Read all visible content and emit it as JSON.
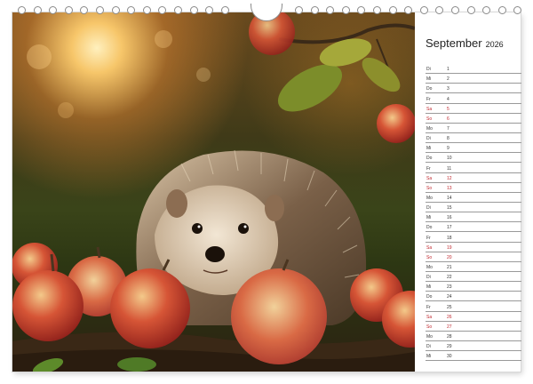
{
  "calendar": {
    "month": "September",
    "year": "2026",
    "days": [
      {
        "dow": "Di",
        "day": "1",
        "weekend": false
      },
      {
        "dow": "Mi",
        "day": "2",
        "weekend": false
      },
      {
        "dow": "Do",
        "day": "3",
        "weekend": false
      },
      {
        "dow": "Fr",
        "day": "4",
        "weekend": false
      },
      {
        "dow": "Sa",
        "day": "5",
        "weekend": true
      },
      {
        "dow": "So",
        "day": "6",
        "weekend": true
      },
      {
        "dow": "Mo",
        "day": "7",
        "weekend": false
      },
      {
        "dow": "Di",
        "day": "8",
        "weekend": false
      },
      {
        "dow": "Mi",
        "day": "9",
        "weekend": false
      },
      {
        "dow": "Do",
        "day": "10",
        "weekend": false
      },
      {
        "dow": "Fr",
        "day": "11",
        "weekend": false
      },
      {
        "dow": "Sa",
        "day": "12",
        "weekend": true
      },
      {
        "dow": "So",
        "day": "13",
        "weekend": true
      },
      {
        "dow": "Mo",
        "day": "14",
        "weekend": false
      },
      {
        "dow": "Di",
        "day": "15",
        "weekend": false
      },
      {
        "dow": "Mi",
        "day": "16",
        "weekend": false
      },
      {
        "dow": "Do",
        "day": "17",
        "weekend": false
      },
      {
        "dow": "Fr",
        "day": "18",
        "weekend": false
      },
      {
        "dow": "Sa",
        "day": "19",
        "weekend": true
      },
      {
        "dow": "So",
        "day": "20",
        "weekend": true
      },
      {
        "dow": "Mo",
        "day": "21",
        "weekend": false
      },
      {
        "dow": "Di",
        "day": "22",
        "weekend": false
      },
      {
        "dow": "Mi",
        "day": "23",
        "weekend": false
      },
      {
        "dow": "Do",
        "day": "24",
        "weekend": false
      },
      {
        "dow": "Fr",
        "day": "25",
        "weekend": false
      },
      {
        "dow": "Sa",
        "day": "26",
        "weekend": true
      },
      {
        "dow": "So",
        "day": "27",
        "weekend": true
      },
      {
        "dow": "Mo",
        "day": "28",
        "weekend": false
      },
      {
        "dow": "Di",
        "day": "29",
        "weekend": false
      },
      {
        "dow": "Mi",
        "day": "30",
        "weekend": false
      }
    ]
  },
  "colors": {
    "weekend": "#c0262d",
    "weekday": "#333333",
    "apple_red": "#c8302a",
    "hedgehog_spines": "#6b5540"
  },
  "photo": {
    "subject_icon": "hedgehog-with-apples"
  }
}
